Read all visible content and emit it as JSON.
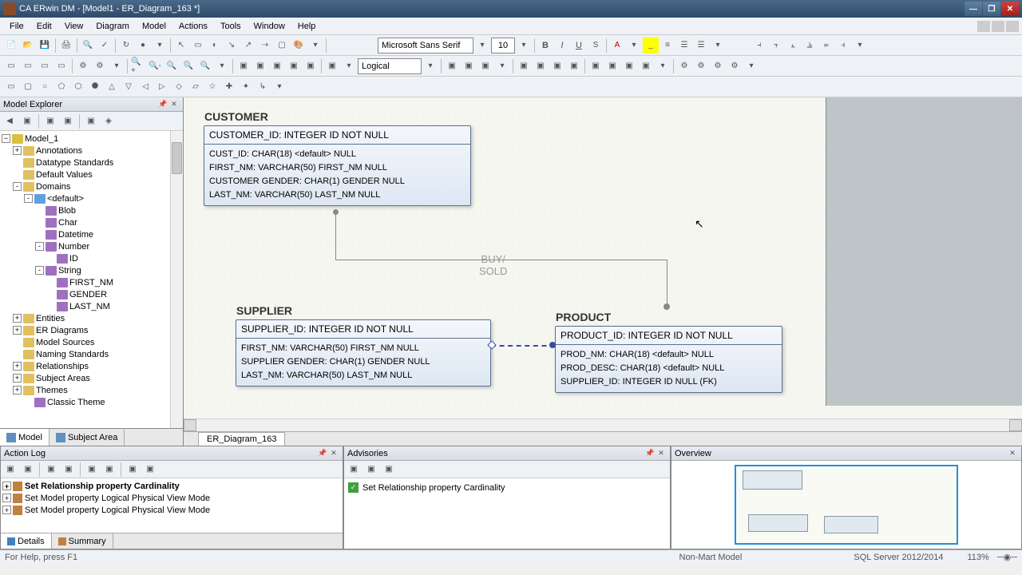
{
  "title": "CA ERwin DM - [Model1 - ER_Diagram_163 *]",
  "menu": [
    "File",
    "Edit",
    "View",
    "Diagram",
    "Model",
    "Actions",
    "Tools",
    "Window",
    "Help"
  ],
  "font": {
    "name": "Microsoft Sans Serif",
    "size": "10"
  },
  "view_mode": "Logical",
  "explorer": {
    "title": "Model Explorer",
    "root": "Model_1",
    "items": [
      {
        "lvl": 1,
        "exp": "+",
        "icon": "folder",
        "label": "Annotations"
      },
      {
        "lvl": 1,
        "exp": "",
        "icon": "folder",
        "label": "Datatype Standards"
      },
      {
        "lvl": 1,
        "exp": "",
        "icon": "folder",
        "label": "Default Values"
      },
      {
        "lvl": 1,
        "exp": "-",
        "icon": "folder",
        "label": "Domains"
      },
      {
        "lvl": 2,
        "exp": "-",
        "icon": "dom",
        "label": "<default>"
      },
      {
        "lvl": 3,
        "exp": "",
        "icon": "type",
        "label": "Blob"
      },
      {
        "lvl": 3,
        "exp": "",
        "icon": "type",
        "label": "Char"
      },
      {
        "lvl": 3,
        "exp": "",
        "icon": "type",
        "label": "Datetime"
      },
      {
        "lvl": 3,
        "exp": "-",
        "icon": "type",
        "label": "Number"
      },
      {
        "lvl": 4,
        "exp": "",
        "icon": "type",
        "label": "ID"
      },
      {
        "lvl": 3,
        "exp": "-",
        "icon": "type",
        "label": "String"
      },
      {
        "lvl": 4,
        "exp": "",
        "icon": "type",
        "label": "FIRST_NM"
      },
      {
        "lvl": 4,
        "exp": "",
        "icon": "type",
        "label": "GENDER"
      },
      {
        "lvl": 4,
        "exp": "",
        "icon": "type",
        "label": "LAST_NM"
      },
      {
        "lvl": 1,
        "exp": "+",
        "icon": "folder",
        "label": "Entities"
      },
      {
        "lvl": 1,
        "exp": "+",
        "icon": "folder",
        "label": "ER Diagrams"
      },
      {
        "lvl": 1,
        "exp": "",
        "icon": "folder",
        "label": "Model Sources"
      },
      {
        "lvl": 1,
        "exp": "",
        "icon": "folder",
        "label": "Naming Standards"
      },
      {
        "lvl": 1,
        "exp": "+",
        "icon": "folder",
        "label": "Relationships"
      },
      {
        "lvl": 1,
        "exp": "+",
        "icon": "folder",
        "label": "Subject Areas"
      },
      {
        "lvl": 1,
        "exp": "+",
        "icon": "folder",
        "label": "Themes"
      },
      {
        "lvl": 2,
        "exp": "",
        "icon": "type",
        "label": "Classic Theme"
      }
    ],
    "tabs": [
      "Model",
      "Subject Area"
    ]
  },
  "entities": {
    "customer": {
      "name": "CUSTOMER",
      "pk": "CUSTOMER_ID: INTEGER ID NOT NULL",
      "attrs": [
        "CUST_ID: CHAR(18) <default> NULL",
        "FIRST_NM: VARCHAR(50) FIRST_NM NULL",
        "CUSTOMER GENDER: CHAR(1) GENDER NULL",
        "LAST_NM: VARCHAR(50) LAST_NM NULL"
      ]
    },
    "supplier": {
      "name": "SUPPLIER",
      "pk": "SUPPLIER_ID: INTEGER ID NOT NULL",
      "attrs": [
        "FIRST_NM: VARCHAR(50) FIRST_NM NULL",
        "SUPPLIER GENDER: CHAR(1) GENDER NULL",
        "LAST_NM: VARCHAR(50) LAST_NM NULL"
      ]
    },
    "product": {
      "name": "PRODUCT",
      "pk": "PRODUCT_ID: INTEGER ID NOT NULL",
      "attrs": [
        "PROD_NM: CHAR(18) <default> NULL",
        "PROD_DESC: CHAR(18) <default> NULL",
        "SUPPLIER_ID: INTEGER ID NULL (FK)"
      ]
    },
    "rel_label": "BUY/\nSOLD"
  },
  "canvas_tab": "ER_Diagram_163",
  "action_log": {
    "title": "Action Log",
    "rows": [
      {
        "bold": true,
        "text": "Set Relationship property Cardinality"
      },
      {
        "bold": false,
        "text": "Set Model property Logical Physical View Mode"
      },
      {
        "bold": false,
        "text": "Set Model property Logical Physical View Mode"
      }
    ],
    "tabs": [
      "Details",
      "Summary"
    ]
  },
  "advisories": {
    "title": "Advisories",
    "rows": [
      "Set Relationship property Cardinality"
    ]
  },
  "overview": {
    "title": "Overview"
  },
  "status": {
    "help": "For Help, press F1",
    "mart": "Non-Mart Model",
    "db": "SQL Server 2012/2014",
    "zoom": "113%"
  }
}
